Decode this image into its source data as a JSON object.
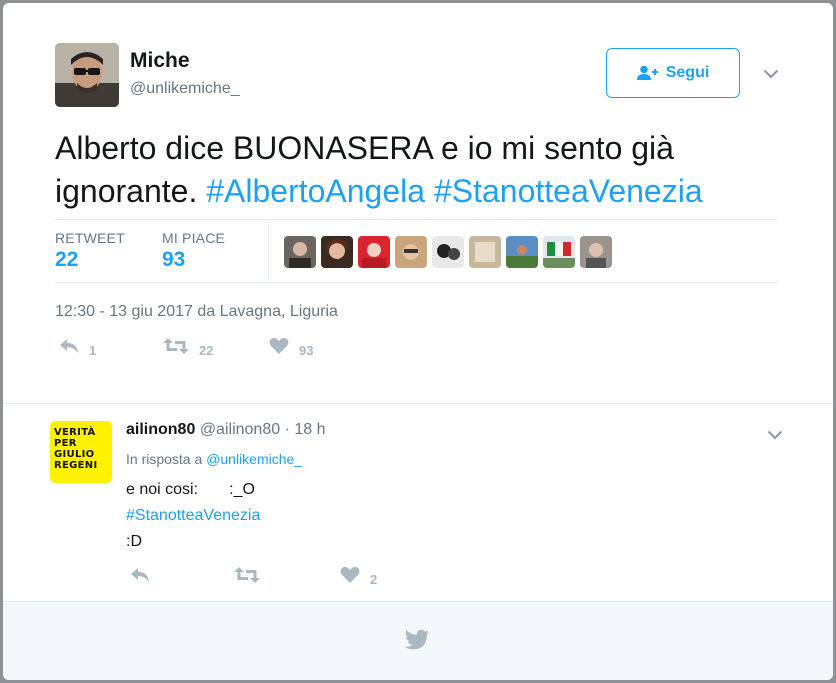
{
  "tweet": {
    "author_name": "Miche",
    "author_handle": "@unlikemiche_",
    "follow_label": "Segui",
    "text_plain": "Alberto dice BUONASERA e io mi sento già ignorante.",
    "hashtags": [
      "#AlbertoAngela",
      "#StanotteaVenezia"
    ],
    "retweet_label": "RETWEET",
    "retweet_count": "22",
    "like_label": "MI PIACE",
    "like_count": "93",
    "timestamp": "12:30 - 13 giu 2017 da Lavagna, Liguria",
    "action_counts": {
      "reply": "1",
      "retweet": "22",
      "like": "93"
    }
  },
  "reply": {
    "author_name": "ailinon80",
    "author_handle": "@ailinon80",
    "time": "· 18 h",
    "in_reply_prefix": "In risposta a",
    "in_reply_handle": "@unlikemiche_",
    "line1": "e noi cosi:       :_O",
    "line2": "#StanotteaVenezia",
    "line3": ":D",
    "avatar_text": [
      "VERITÀ",
      "PER",
      "GIULIO",
      "REGENI"
    ],
    "action_counts": {
      "like": "2"
    }
  },
  "icons": {
    "follow": "add-user-icon",
    "caret": "chevron-down-icon",
    "reply": "reply-icon",
    "retweet": "retweet-icon",
    "like": "heart-icon",
    "footer": "twitter-bird-icon"
  },
  "colors": {
    "accent": "#1da1f2",
    "muted": "#657786",
    "icon": "#aab8c2",
    "avatar_yellow": "#fff200"
  }
}
